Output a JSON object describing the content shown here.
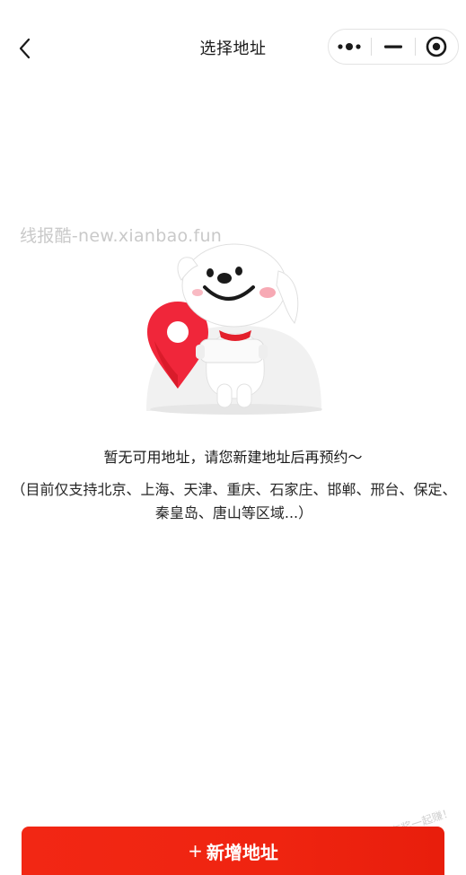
{
  "header": {
    "title": "选择地址"
  },
  "watermark": {
    "text": "线报酷-new.xianbao.fun",
    "corner_text": "线报酷 · 有奖一起赚！"
  },
  "empty_state": {
    "message": "暂无可用地址，请您新建地址后再预约～",
    "support_note": "（目前仅支持北京、上海、天津、重庆、石家庄、邯郸、邢台、保定、秦皇岛、唐山等区域...）"
  },
  "footer": {
    "add_plus": "+",
    "add_label": "新增地址"
  },
  "icons": {
    "back": "chevron-left-icon",
    "more": "more-dots-icon",
    "minimize": "minimize-icon",
    "close": "target-close-icon",
    "illustration": "mascot-dog-location-pin"
  },
  "colors": {
    "accent": "#f22714",
    "pin": "#f0263a"
  }
}
